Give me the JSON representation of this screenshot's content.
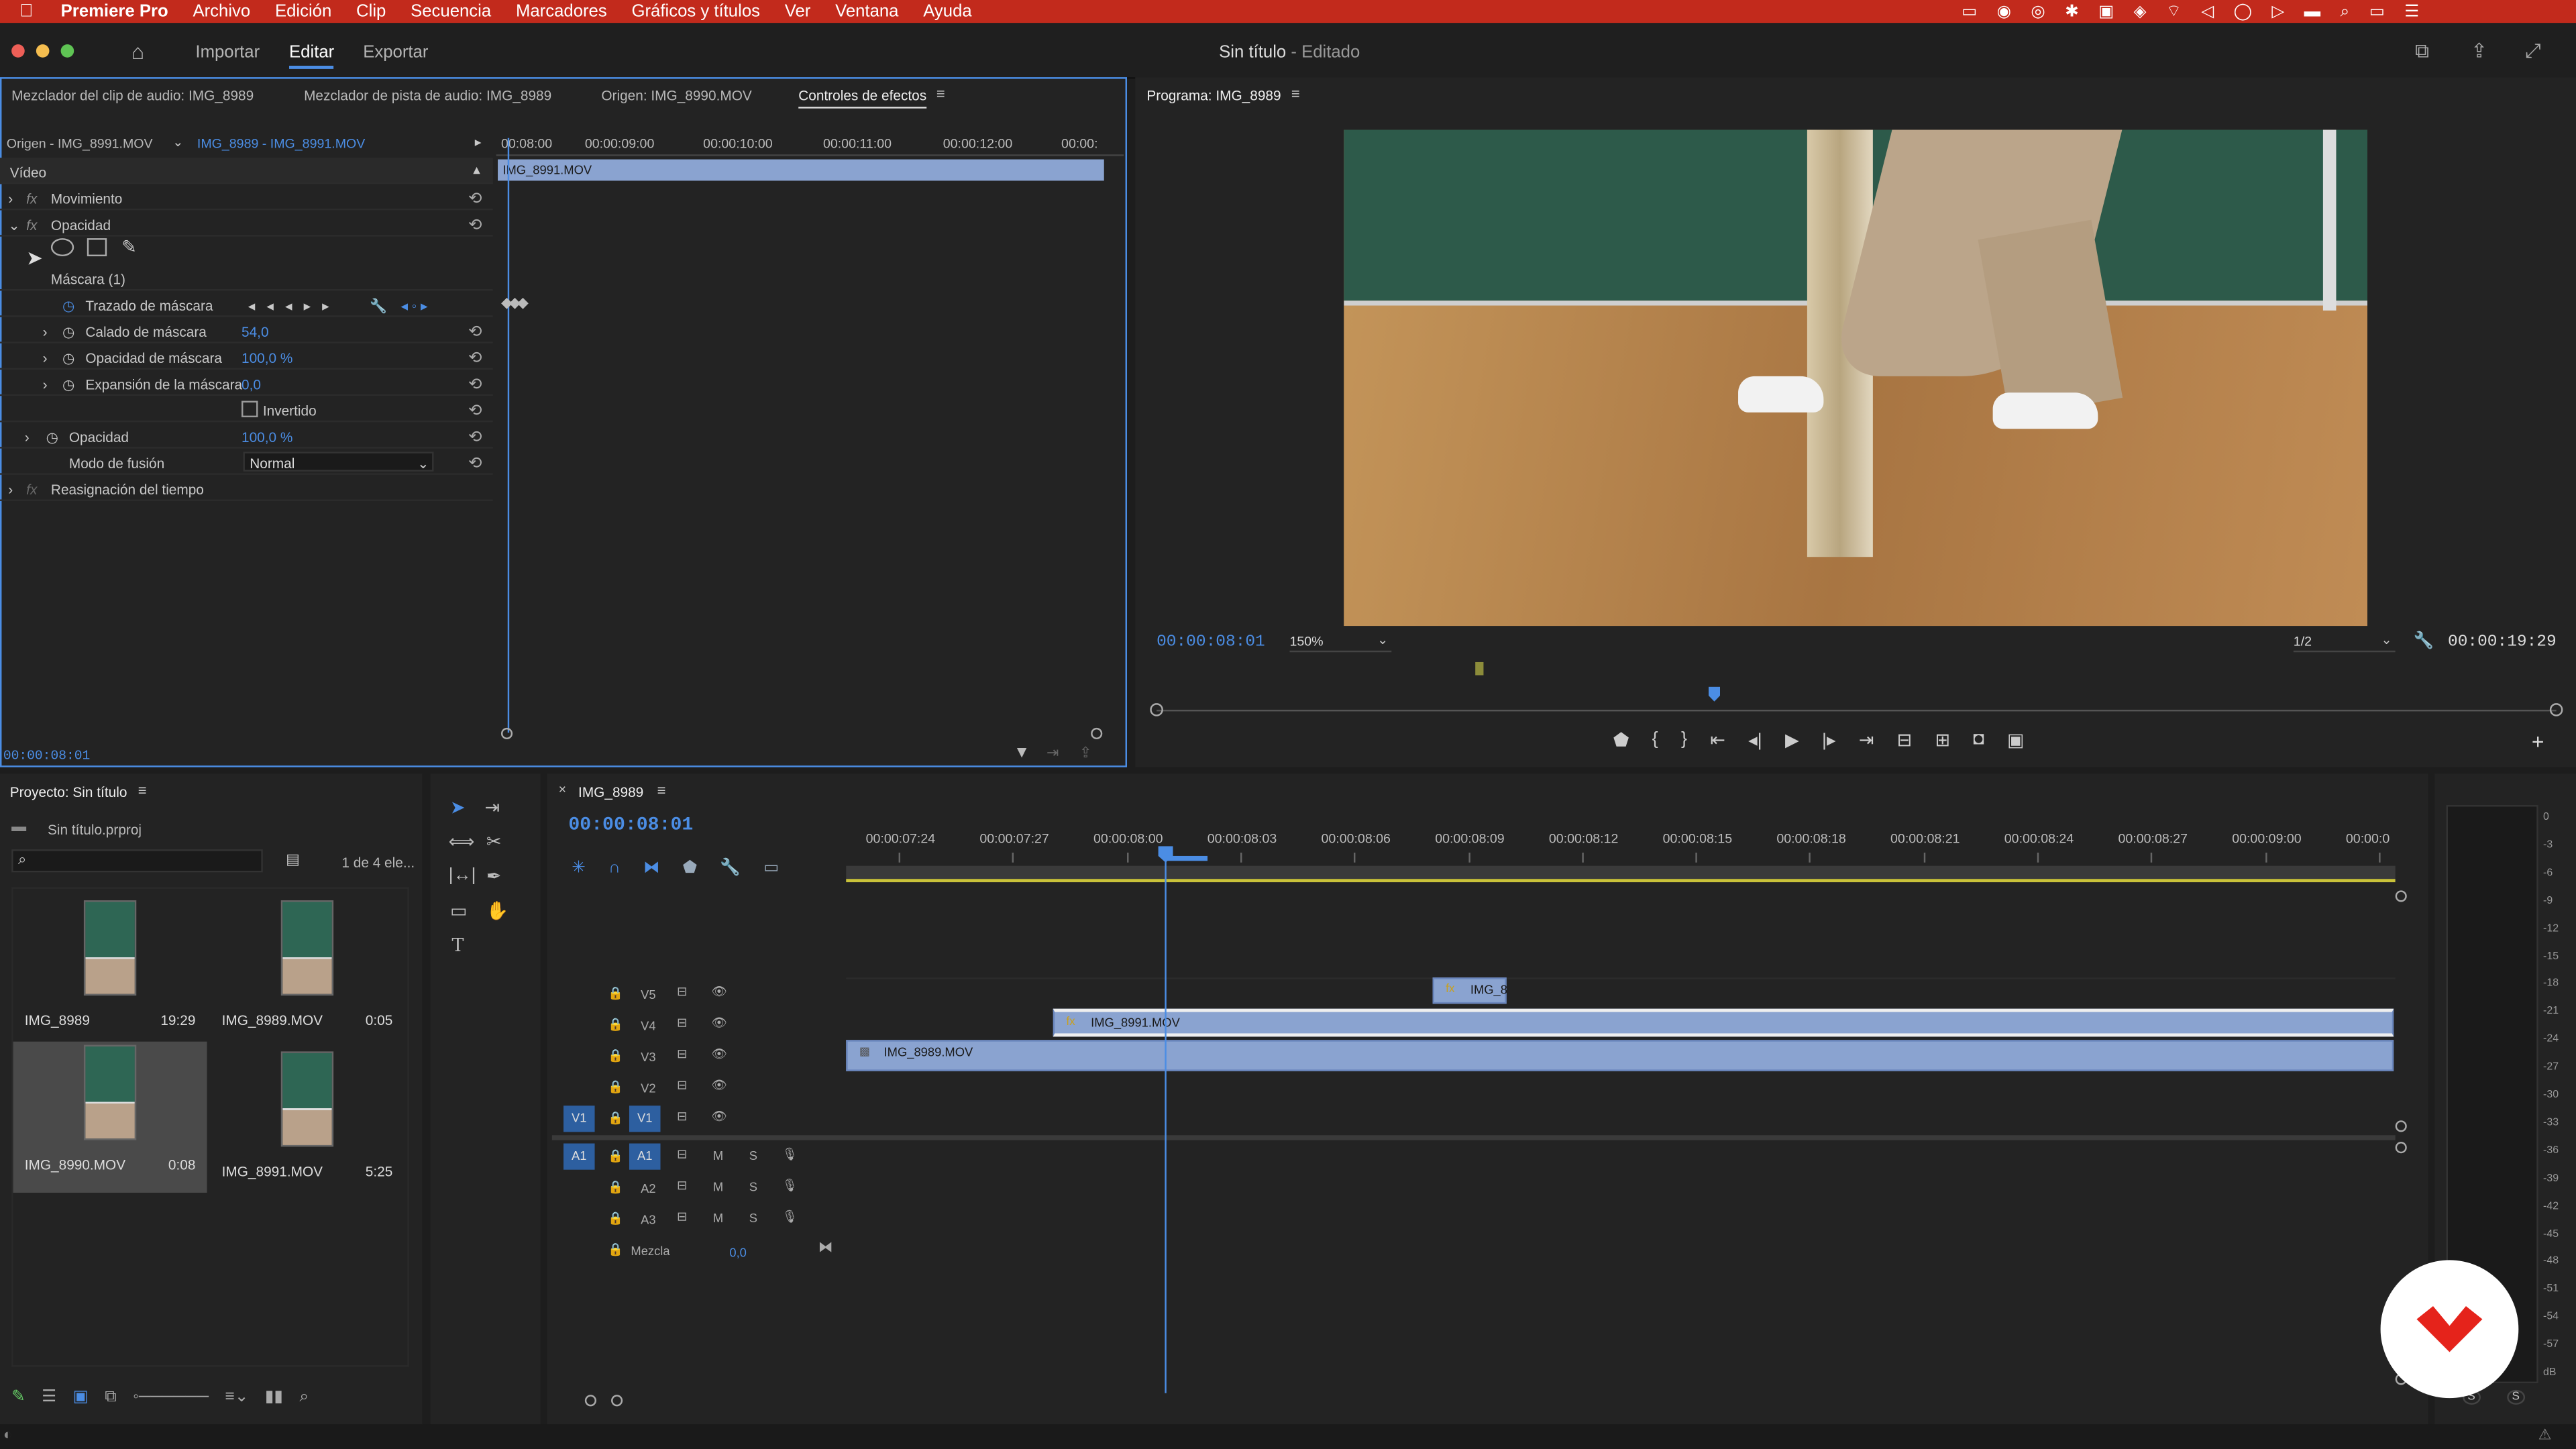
{
  "menubar": {
    "app": "Premiere Pro",
    "items": [
      "Archivo",
      "Edición",
      "Clip",
      "Secuencia",
      "Marcadores",
      "Gráficos y títulos",
      "Ver",
      "Ventana",
      "Ayuda"
    ]
  },
  "window": {
    "title": "Sin título",
    "title_suffix": " - Editado"
  },
  "workspaces": {
    "import": "Importar",
    "edit": "Editar",
    "export": "Exportar"
  },
  "effects_panel": {
    "tabs": [
      "Mezclador del clip de audio: IMG_8989",
      "Mezclador de pista de audio: IMG_8989",
      "Origen: IMG_8990.MOV",
      "Controles de efectos"
    ],
    "source": "Origen - IMG_8991.MOV",
    "sequence": "IMG_8989 - IMG_8991.MOV",
    "section_video": "Vídeo",
    "rows": {
      "movimiento": "Movimiento",
      "opacidad": "Opacidad",
      "mascara": "Máscara (1)",
      "trazado": "Trazado de máscara",
      "calado": "Calado de máscara",
      "calado_val": "54,0",
      "opmask": "Opacidad de máscara",
      "opmask_val": "100,0 %",
      "expansion": "Expansión de la máscara",
      "expansion_val": "0,0",
      "invertido": "Invertido",
      "opacidad2": "Opacidad",
      "opacidad2_val": "100,0 %",
      "fusion": "Modo de fusión",
      "fusion_val": "Normal",
      "reasign": "Reasignación del tiempo"
    },
    "ruler": [
      "00:08:00",
      "00:00:09:00",
      "00:00:10:00",
      "00:00:11:00",
      "00:00:12:00",
      "00:00:"
    ],
    "clip": "IMG_8991.MOV",
    "timecode": "00:00:08:01"
  },
  "program": {
    "title": "Programa: IMG_8989",
    "timecode": "00:00:08:01",
    "zoom": "150%",
    "resolution": "1/2",
    "duration": "00:00:19:29"
  },
  "project": {
    "title": "Proyecto: Sin título",
    "file": "Sin título.prproj",
    "count": "1 de 4 ele...",
    "items": [
      {
        "name": "IMG_8989",
        "dur": "19:29"
      },
      {
        "name": "IMG_8989.MOV",
        "dur": "0:05"
      },
      {
        "name": "IMG_8990.MOV",
        "dur": "0:08"
      },
      {
        "name": "IMG_8991.MOV",
        "dur": "5:25"
      }
    ]
  },
  "timeline": {
    "tab": "IMG_8989",
    "timecode": "00:00:08:01",
    "ruler": [
      "00:00:07:24",
      "00:00:07:27",
      "00:00:08:00",
      "00:00:08:03",
      "00:00:08:06",
      "00:00:08:09",
      "00:00:08:12",
      "00:00:08:15",
      "00:00:08:18",
      "00:00:08:21",
      "00:00:08:24",
      "00:00:08:27",
      "00:00:09:00",
      "00:00:0"
    ],
    "video_tracks": [
      "V5",
      "V4",
      "V3",
      "V2",
      "V1"
    ],
    "audio_tracks": [
      "A1",
      "A2",
      "A3"
    ],
    "src_v": "V1",
    "src_a": "A1",
    "mix": "Mezcla",
    "mix_val": "0,0",
    "clips": {
      "v5": "IMG_8",
      "v4": "IMG_8991.MOV",
      "v3": "IMG_8989.MOV"
    },
    "m": "M",
    "s": "S"
  },
  "meter": {
    "labels": [
      "0",
      "-3",
      "-6",
      "-9",
      "-12",
      "-15",
      "-18",
      "-21",
      "-24",
      "-27",
      "-30",
      "-33",
      "-36",
      "-39",
      "-42",
      "-45",
      "-48",
      "-51",
      "-54",
      "-57",
      "dB"
    ],
    "s1": "S",
    "s2": "S"
  },
  "colors": {
    "accent": "#4b8de4",
    "menubar": "#c22a1c",
    "clip": "#8aa3d0",
    "logo": "#e5231b"
  }
}
